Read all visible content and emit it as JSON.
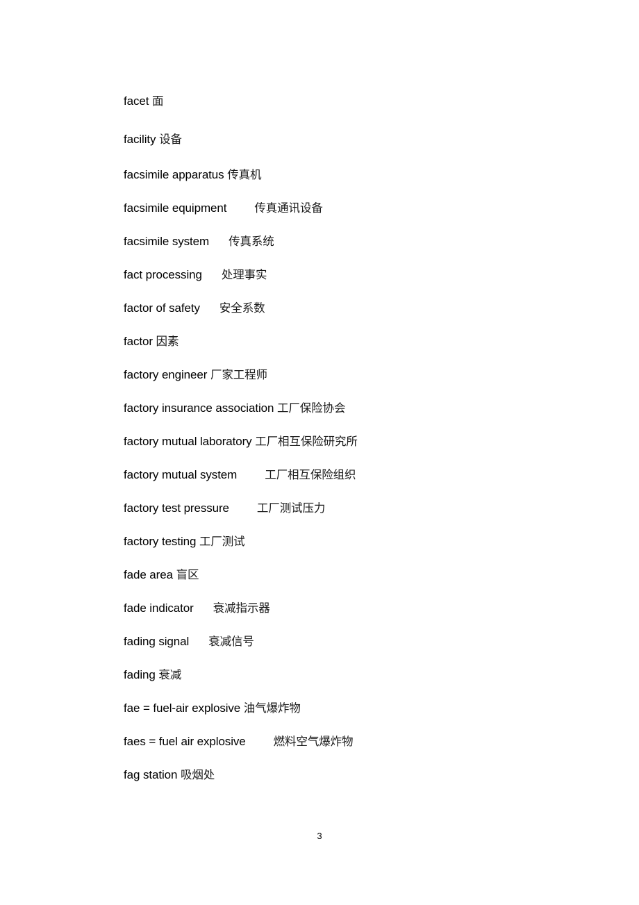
{
  "document": {
    "page_number": "3",
    "text_color": "#000000",
    "background_color": "#ffffff",
    "entries": [
      {
        "term": "facet",
        "separator": "space",
        "translation": "面"
      },
      {
        "term": "facility",
        "separator": "space",
        "translation": "设备"
      },
      {
        "term": "facsimile apparatus",
        "separator": "space",
        "translation": "传真机"
      },
      {
        "term": "facsimile equipment",
        "separator": "tab-md",
        "translation": "传真通讯设备"
      },
      {
        "term": "facsimile system",
        "separator": "tab-sm",
        "translation": "传真系统"
      },
      {
        "term": "fact processing",
        "separator": "tab-sm",
        "translation": "处理事实"
      },
      {
        "term": "factor of safety",
        "separator": "tab-sm",
        "translation": "安全系数"
      },
      {
        "term": "factor",
        "separator": "space",
        "translation": "因素"
      },
      {
        "term": "factory engineer",
        "separator": "space",
        "translation": "厂家工程师"
      },
      {
        "term": "factory insurance association",
        "separator": "space",
        "translation": "工厂保险协会"
      },
      {
        "term": "factory mutual laboratory",
        "separator": "space",
        "translation": "工厂相互保险研究所"
      },
      {
        "term": "factory mutual system",
        "separator": "tab-md",
        "translation": "工厂相互保险组织"
      },
      {
        "term": "factory test pressure",
        "separator": "tab-md",
        "translation": "工厂测试压力"
      },
      {
        "term": "factory testing",
        "separator": "space",
        "translation": "工厂测试"
      },
      {
        "term": "fade area",
        "separator": "space",
        "translation": "盲区"
      },
      {
        "term": "fade indicator",
        "separator": "tab-sm",
        "translation": "衰减指示器"
      },
      {
        "term": "fading signal",
        "separator": "tab-sm",
        "translation": "衰减信号"
      },
      {
        "term": "fading",
        "separator": "space",
        "translation": "衰减"
      },
      {
        "term": "fae = fuel-air explosive",
        "separator": "space",
        "translation": "油气爆炸物"
      },
      {
        "term": "faes = fuel air explosive",
        "separator": "tab-md",
        "translation": "燃料空气爆炸物"
      },
      {
        "term": "fag station",
        "separator": "space",
        "translation": "吸烟处"
      }
    ]
  }
}
